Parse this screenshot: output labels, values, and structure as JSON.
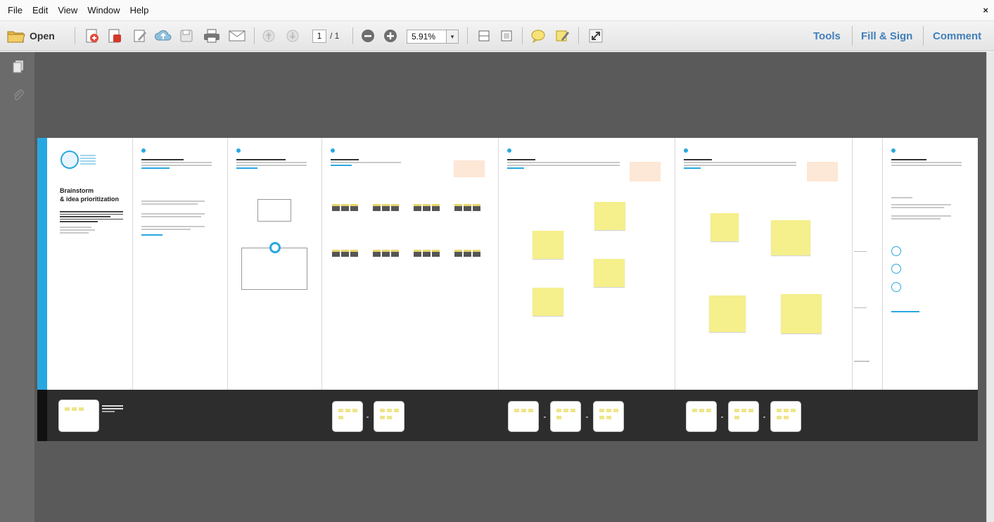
{
  "menu": {
    "items": [
      "File",
      "Edit",
      "View",
      "Window",
      "Help"
    ],
    "close_label": "×"
  },
  "toolbar": {
    "open_label": "Open",
    "page_current": "1",
    "page_total": "/ 1",
    "zoom_value": "5.91%",
    "zoom_dropdown": "▾",
    "right_links": {
      "tools": "Tools",
      "fill_sign": "Fill & Sign",
      "comment": "Comment"
    },
    "icons": [
      "open-folder-icon",
      "create-pdf-icon",
      "export-pdf-icon",
      "edit-icon",
      "cloud-upload-icon",
      "save-icon",
      "print-icon",
      "email-icon",
      "prev-page-icon",
      "next-page-icon",
      "zoom-out-icon",
      "zoom-in-icon",
      "fit-width-icon",
      "fit-page-icon",
      "comment-bubble-icon",
      "highlight-icon",
      "fullscreen-icon"
    ]
  },
  "left_panel": {
    "icons": [
      "pages-icon",
      "attachment-icon"
    ]
  },
  "document": {
    "intro_title_line1": "Brainstorm",
    "intro_title_line2": "& idea prioritization",
    "colors": {
      "accent": "#29a7e1",
      "sticky": "#f5ef8c",
      "background": "#5a5a5a",
      "strip": "#2d2d2d"
    }
  }
}
